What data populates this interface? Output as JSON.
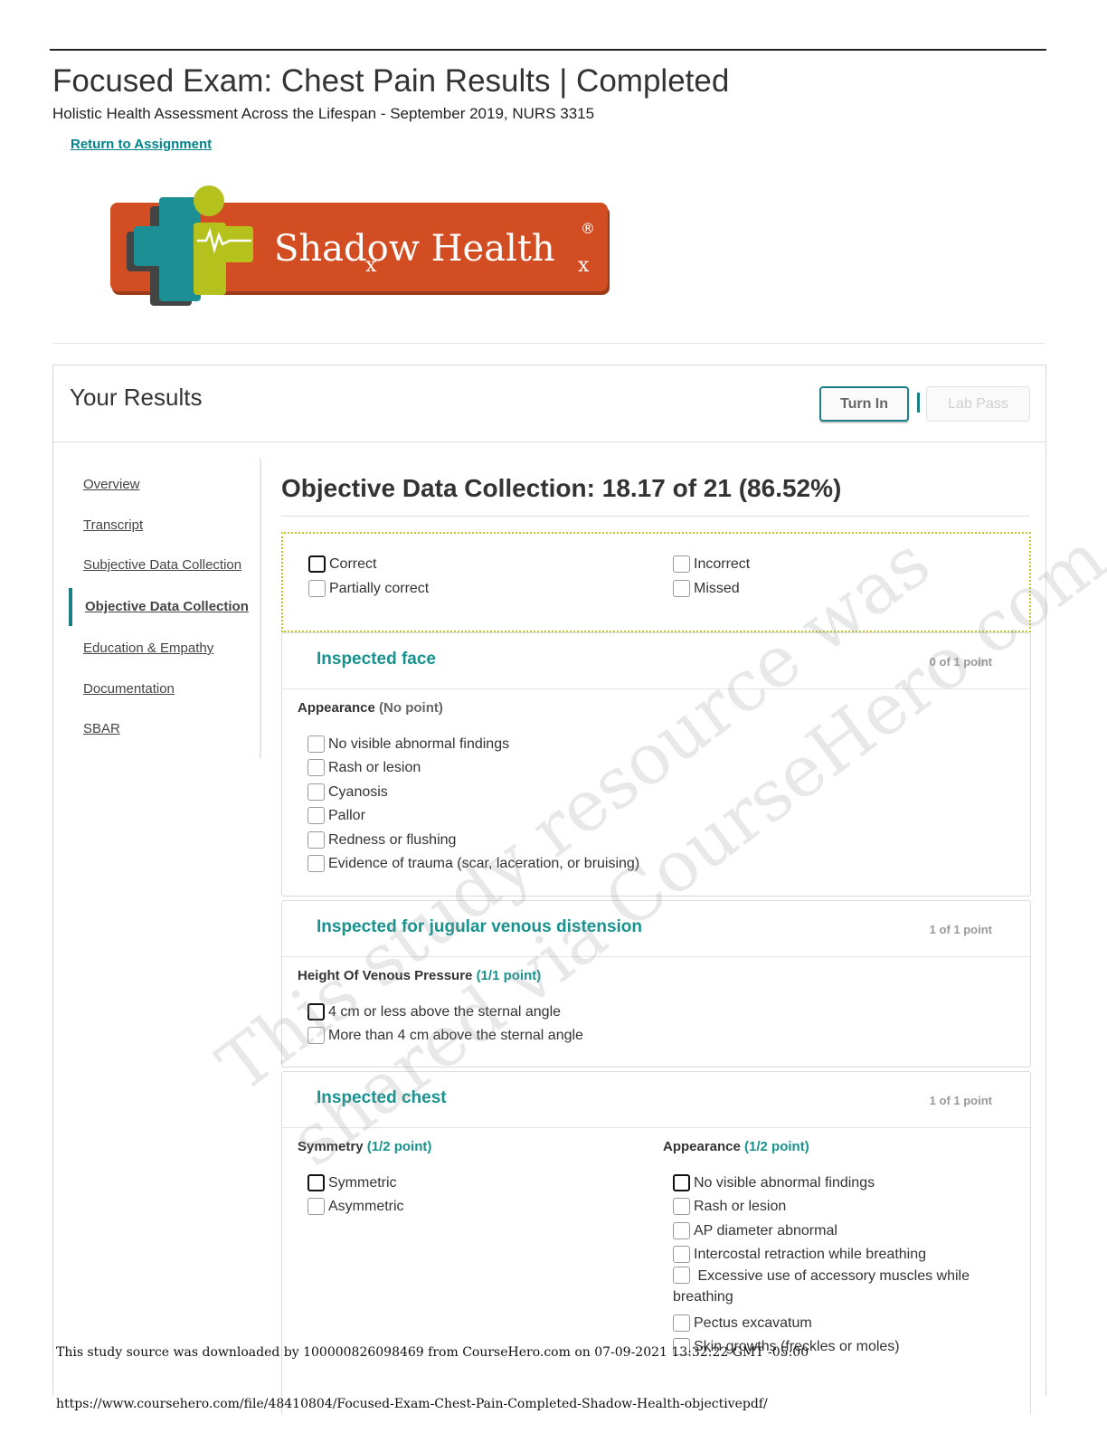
{
  "page": {
    "title": "Focused Exam: Chest Pain Results | Completed",
    "course": "Holistic Health Assessment Across the Lifespan - September 2019, NURS 3315",
    "return_link": "Return to Assignment"
  },
  "logo": {
    "text": "Shadow Health",
    "registered": "®",
    "subscript": "x"
  },
  "results": {
    "title": "Your Results",
    "turn_in": "Turn In",
    "lab_pass": "Lab Pass"
  },
  "nav": {
    "items": [
      {
        "label": "Overview"
      },
      {
        "label": "Transcript"
      },
      {
        "label": "Subjective Data Collection"
      },
      {
        "label": "Objective Data Collection"
      },
      {
        "label": "Education & Empathy"
      },
      {
        "label": "Documentation"
      },
      {
        "label": "SBAR"
      }
    ],
    "active": "Objective Data Collection"
  },
  "section": {
    "title": "Objective Data Collection: 18.17 of 21 (86.52%)"
  },
  "legend": {
    "correct": "Correct",
    "partially_correct": "Partially correct",
    "incorrect": "Incorrect",
    "missed": "Missed"
  },
  "cards": [
    {
      "title": "Inspected face",
      "points": "0 of 1 point",
      "groups": [
        {
          "label": "Appearance",
          "points": "(No point)",
          "options": [
            "No visible abnormal findings",
            "Rash or lesion",
            "Cyanosis",
            "Pallor",
            "Redness or flushing",
            "Evidence of trauma (scar, laceration, or bruising)"
          ]
        }
      ]
    },
    {
      "title": "Inspected for jugular venous distension",
      "points": "1 of 1 point",
      "groups": [
        {
          "label": "Height Of Venous Pressure",
          "points": "(1/1 point)",
          "options": [
            "4 cm or less above the sternal angle",
            "More than 4 cm above the sternal angle"
          ]
        }
      ]
    },
    {
      "title": "Inspected chest",
      "points": "1 of 1 point",
      "groups": [
        {
          "label": "Symmetry",
          "points": "(1/2 point)",
          "options": [
            "Symmetric",
            "Asymmetric"
          ]
        },
        {
          "label": "Appearance",
          "points": "(1/2 point)",
          "options": [
            "No visible abnormal findings",
            "Rash or lesion",
            "AP diameter abnormal",
            "Intercostal retraction while breathing",
            "Excessive use of accessory muscles while breathing",
            "Pectus excavatum",
            "Skin growths (freckles or moles)"
          ]
        }
      ]
    }
  ],
  "watermark": {
    "line1": "This study resource was",
    "line2": "shared via CourseHero.com"
  },
  "footer": {
    "source": "This study source was downloaded by 100000826098469 from CourseHero.com on 07-09-2021 13:32:22 GMT -05:00",
    "url": "https://www.coursehero.com/file/48410804/Focused-Exam-Chest-Pain-Completed-Shadow-Health-objectivepdf/"
  },
  "colors": {
    "teal": "#18928f",
    "logo_orange": "#d24d22",
    "legend_border": "#c5c32a"
  }
}
